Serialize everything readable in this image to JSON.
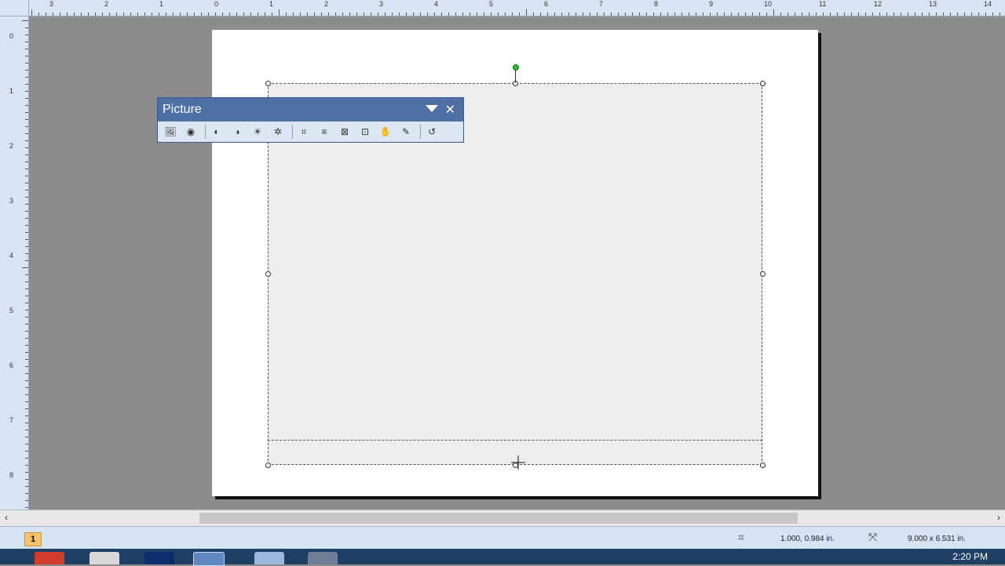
{
  "rulers": {
    "horizontal_labels": [
      "3",
      "2",
      "1",
      "0",
      "1",
      "2",
      "3",
      "4",
      "5",
      "6",
      "7",
      "8",
      "9",
      "10",
      "11",
      "12",
      "13",
      "14"
    ],
    "vertical_labels": [
      "0",
      "1",
      "2",
      "3",
      "4",
      "5",
      "6",
      "7",
      "8"
    ]
  },
  "picture_toolbar": {
    "title": "Picture",
    "close_glyph": "✕",
    "buttons": [
      {
        "name": "insert-picture-icon",
        "glyph": "🖼"
      },
      {
        "name": "color-icon",
        "glyph": "◉"
      },
      {
        "name": "more-contrast-icon",
        "glyph": "◐"
      },
      {
        "name": "less-contrast-icon",
        "glyph": "◑"
      },
      {
        "name": "more-brightness-icon",
        "glyph": "☀"
      },
      {
        "name": "less-brightness-icon",
        "glyph": "✲"
      },
      {
        "name": "crop-icon",
        "glyph": "⌗"
      },
      {
        "name": "line-style-icon",
        "glyph": "≡"
      },
      {
        "name": "compress-pictures-icon",
        "glyph": "⊠"
      },
      {
        "name": "text-wrapping-icon",
        "glyph": "⊡"
      },
      {
        "name": "format-picture-icon",
        "glyph": "✋"
      },
      {
        "name": "set-transparent-color-icon",
        "glyph": "✎"
      },
      {
        "name": "reset-picture-icon",
        "glyph": "↺"
      }
    ]
  },
  "status": {
    "page_number": "1",
    "position": "1.000, 0.984 in.",
    "size": "9.000 x 6.531 in."
  },
  "taskbar": {
    "clock": "2:20 PM"
  }
}
